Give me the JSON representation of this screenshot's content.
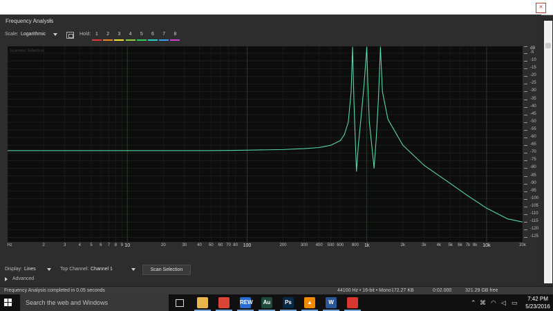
{
  "window": {
    "close_glyph": "×"
  },
  "panel": {
    "title": "Frequency Analysis",
    "menu_glyph": "≡",
    "scale_label": "Scale:",
    "scale_value": "Logarithmic",
    "hold_label": "Hold:",
    "hold_slots": [
      {
        "label": "1",
        "color": "#e53935"
      },
      {
        "label": "2",
        "color": "#ef8a1c"
      },
      {
        "label": "3",
        "color": "#f5e72a"
      },
      {
        "label": "4",
        "color": "#8bd13b"
      },
      {
        "label": "5",
        "color": "#2ecc55"
      },
      {
        "label": "6",
        "color": "#24d3c0"
      },
      {
        "label": "7",
        "color": "#3b9df0"
      },
      {
        "label": "8",
        "color": "#d43fd6"
      }
    ]
  },
  "plot": {
    "legend": "Scanned Selection"
  },
  "chart_data": {
    "type": "line",
    "xlabel": "Hz",
    "ylabel": "dB",
    "xscale": "log",
    "xlim": [
      1,
      20000
    ],
    "ylim": [
      -128,
      -0.5
    ],
    "x_ticks": [
      "Hz",
      "2",
      "3",
      "4",
      "5",
      "6",
      "7",
      "8",
      "9",
      "10",
      "20",
      "30",
      "40",
      "50",
      "60",
      "70",
      "80",
      "100",
      "200",
      "300",
      "400",
      "500",
      "600",
      "800",
      "1k",
      "2k",
      "3k",
      "4k",
      "5k",
      "6k",
      "7k",
      "8k",
      "10k",
      "20k"
    ],
    "x_tick_values": [
      1,
      2,
      3,
      4,
      5,
      6,
      7,
      8,
      9,
      10,
      20,
      30,
      40,
      50,
      60,
      70,
      80,
      100,
      200,
      300,
      400,
      500,
      600,
      800,
      1000,
      2000,
      3000,
      4000,
      5000,
      6000,
      7000,
      8000,
      10000,
      20000
    ],
    "y_ticks": [
      "dB",
      "-5",
      "-10",
      "-15",
      "-20",
      "-25",
      "-30",
      "-35",
      "-40",
      "-45",
      "-50",
      "-55",
      "-60",
      "-65",
      "-70",
      "-75",
      "-80",
      "-85",
      "-90",
      "-95",
      "-100",
      "-105",
      "-110",
      "-115",
      "-120",
      "-125"
    ],
    "y_tick_values": [
      0,
      -5,
      -10,
      -15,
      -20,
      -25,
      -30,
      -35,
      -40,
      -45,
      -50,
      -55,
      -60,
      -65,
      -70,
      -75,
      -80,
      -85,
      -90,
      -95,
      -100,
      -105,
      -110,
      -115,
      -120,
      -125
    ],
    "grid": true,
    "line_color": "#55d8a8",
    "series": [
      {
        "x": [
          1,
          10,
          50,
          100,
          200,
          300,
          400,
          500,
          600,
          650,
          700,
          740,
          760,
          780,
          800,
          820,
          850,
          900,
          950,
          1000,
          1020,
          1050,
          1100,
          1150,
          1200,
          1250,
          1300,
          1350,
          1500,
          2000,
          3000,
          5000,
          7000,
          10000,
          15000,
          20000
        ],
        "y": [
          -68.5,
          -68.5,
          -68.5,
          -68.2,
          -67.8,
          -67.2,
          -66.5,
          -65,
          -62,
          -58,
          -50,
          -30,
          -1,
          -35,
          -60,
          -82,
          -65,
          -45,
          -25,
          -1,
          -25,
          -50,
          -65,
          -80,
          -60,
          -35,
          -1,
          -30,
          -48,
          -65,
          -78,
          -90,
          -98,
          -106,
          -113,
          -115
        ]
      }
    ]
  },
  "bottom": {
    "display_label": "Display:",
    "display_value": "Lines",
    "top_channel_label": "Top Channel:",
    "top_channel_value": "Channel 1",
    "scan_button": "Scan Selection",
    "advanced_label": "Advanced"
  },
  "status": {
    "message": "Frequency Analysis completed in 0.05 seconds",
    "format": "44100 Hz • 16-bit • Mono",
    "size": "172.27 KB",
    "duration": "0:02.000",
    "free": "321.29 GB free"
  },
  "taskbar": {
    "search_placeholder": "Search the web and Windows",
    "apps": [
      {
        "name": "file-explorer",
        "glyph": "",
        "color": "#e8b64a"
      },
      {
        "name": "chrome",
        "glyph": "",
        "color": "#db4437"
      },
      {
        "name": "rew",
        "glyph": "REW",
        "color": "#2a6bd1"
      },
      {
        "name": "audition",
        "glyph": "Au",
        "color": "#1f4a3e"
      },
      {
        "name": "photoshop",
        "glyph": "Ps",
        "color": "#0a2a4a"
      },
      {
        "name": "vlc",
        "glyph": "▲",
        "color": "#f08a00"
      },
      {
        "name": "word",
        "glyph": "W",
        "color": "#2b5796"
      },
      {
        "name": "acrobat",
        "glyph": "",
        "color": "#d7372f"
      }
    ],
    "time": "7:42 PM",
    "date": "5/23/2016"
  }
}
